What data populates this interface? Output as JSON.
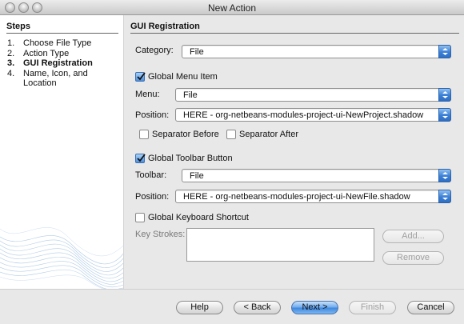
{
  "window": {
    "title": "New Action"
  },
  "steps": {
    "heading": "Steps",
    "items": [
      {
        "num": "1.",
        "label": "Choose File Type"
      },
      {
        "num": "2.",
        "label": "Action Type"
      },
      {
        "num": "3.",
        "label": "GUI Registration"
      },
      {
        "num": "4.",
        "label": "Name, Icon, and Location"
      }
    ],
    "active_index": 2
  },
  "panel": {
    "heading": "GUI Registration",
    "category": {
      "label": "Category:",
      "value": "File"
    },
    "global_menu_item": {
      "label": "Global Menu Item",
      "checked": true,
      "menu": {
        "label": "Menu:",
        "value": "File"
      },
      "position": {
        "label": "Position:",
        "value": "HERE - org-netbeans-modules-project-ui-NewProject.shadow"
      },
      "separator_before": {
        "label": "Separator Before",
        "checked": false
      },
      "separator_after": {
        "label": "Separator After",
        "checked": false
      }
    },
    "global_toolbar_button": {
      "label": "Global Toolbar Button",
      "checked": true,
      "toolbar": {
        "label": "Toolbar:",
        "value": "File"
      },
      "position": {
        "label": "Position:",
        "value": "HERE - org-netbeans-modules-project-ui-NewFile.shadow"
      }
    },
    "global_keyboard_shortcut": {
      "label": "Global Keyboard Shortcut",
      "checked": false,
      "key_strokes_label": "Key Strokes:",
      "add_label": "Add...",
      "remove_label": "Remove"
    }
  },
  "buttons": {
    "help": "Help",
    "back": "< Back",
    "next": "Next >",
    "finish": "Finish",
    "cancel": "Cancel"
  },
  "colors": {
    "accent": "#3d86de",
    "checked_box": "#4d8fdc"
  }
}
